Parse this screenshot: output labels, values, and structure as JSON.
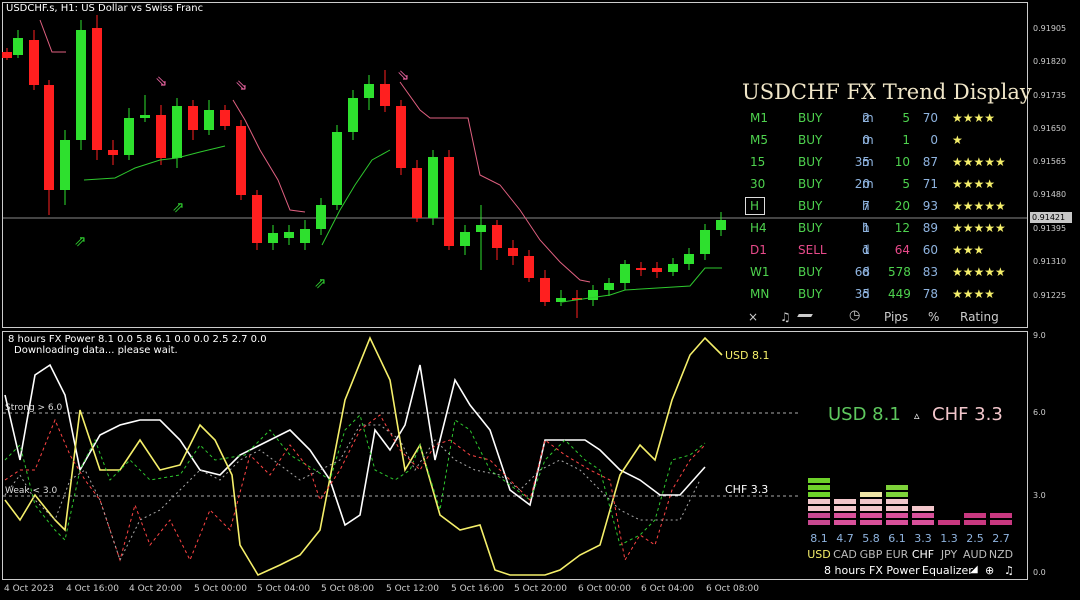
{
  "chart": {
    "title": "USDCHF.s, H1:  US Dollar vs Swiss Franc",
    "current_price": "0.91421",
    "price_axis": [
      "0.91905",
      "0.91820",
      "0.91735",
      "0.91650",
      "0.91565",
      "0.91480",
      "0.91395",
      "0.91310",
      "0.91225"
    ],
    "time_axis": [
      "4 Oct 2023",
      "4 Oct 16:00",
      "4 Oct 20:00",
      "5 Oct 00:00",
      "5 Oct 04:00",
      "5 Oct 08:00",
      "5 Oct 12:00",
      "5 Oct 16:00",
      "5 Oct 20:00",
      "6 Oct 00:00",
      "6 Oct 04:00",
      "6 Oct 08:00"
    ]
  },
  "trend_display": {
    "title": "USDCHF FX Trend Display",
    "rows": [
      {
        "tf": "M1",
        "signal": "BUY",
        "dur": "2",
        "unit": "m",
        "pips": "5",
        "pct": "70",
        "stars": "★★★★",
        "color": "#4ed24e"
      },
      {
        "tf": "M5",
        "signal": "BUY",
        "dur": "0",
        "unit": "m",
        "pips": "1",
        "pct": "0",
        "stars": "★",
        "color": "#4ed24e"
      },
      {
        "tf": "15",
        "signal": "BUY",
        "dur": "35",
        "unit": "m",
        "pips": "10",
        "pct": "87",
        "stars": "★★★★★",
        "color": "#4ed24e"
      },
      {
        "tf": "30",
        "signal": "BUY",
        "dur": "20",
        "unit": "m",
        "pips": "5",
        "pct": "71",
        "stars": "★★★★",
        "color": "#4ed24e"
      },
      {
        "tf": "H",
        "signal": "BUY",
        "dur": "7",
        "unit": "h",
        "pips": "20",
        "pct": "93",
        "stars": "★★★★★",
        "color": "#4ed24e"
      },
      {
        "tf": "H4",
        "signal": "BUY",
        "dur": "1",
        "unit": "h",
        "pips": "12",
        "pct": "89",
        "stars": "★★★★★",
        "color": "#4ed24e"
      },
      {
        "tf": "D1",
        "signal": "SELL",
        "dur": "1",
        "unit": "d",
        "pips": "64",
        "pct": "60",
        "stars": "★★★",
        "color": "#e84a8a"
      },
      {
        "tf": "W1",
        "signal": "BUY",
        "dur": "68",
        "unit": "d",
        "pips": "578",
        "pct": "83",
        "stars": "★★★★★",
        "color": "#4ed24e"
      },
      {
        "tf": "MN",
        "signal": "BUY",
        "dur": "35",
        "unit": "d",
        "pips": "449",
        "pct": "78",
        "stars": "★★★★",
        "color": "#4ed24e"
      }
    ],
    "footer": {
      "close": "×",
      "sound": "♫",
      "clock": "◷",
      "pips": "Pips",
      "pct": "%",
      "rating": "Rating"
    }
  },
  "indicator": {
    "title": "8 hours FX Power 8.1 0.0 5.8 6.1 0.0 0.0 2.5 2.7 0.0",
    "status": "Downloading data... please wait.",
    "strong_label": "Strong > 6.0",
    "weak_label": "Weak < 3.0",
    "axis": [
      "9.0",
      "6.0",
      "3.0",
      "0.0"
    ],
    "usd_label": "USD 8.1",
    "chf_label": "CHF 3.3",
    "headline_usd": "USD 8.1",
    "headline_arrow": "▵",
    "headline_chf": "CHF 3.3"
  },
  "equalizer": {
    "currencies": [
      {
        "code": "USD",
        "value": "8.1",
        "strength": 8.1,
        "code_color": "#f5ef6a"
      },
      {
        "code": "CAD",
        "value": "4.7",
        "strength": 4.7,
        "code_color": "#bbbbbb"
      },
      {
        "code": "GBP",
        "value": "5.8",
        "strength": 5.8,
        "code_color": "#bbbbbb"
      },
      {
        "code": "EUR",
        "value": "6.1",
        "strength": 6.1,
        "code_color": "#bbbbbb"
      },
      {
        "code": "CHF",
        "value": "3.3",
        "strength": 3.3,
        "code_color": "#ffffff"
      },
      {
        "code": "JPY",
        "value": "1.3",
        "strength": 1.3,
        "code_color": "#bbbbbb"
      },
      {
        "code": "AUD",
        "value": "2.5",
        "strength": 2.5,
        "code_color": "#bbbbbb"
      },
      {
        "code": "NZD",
        "value": "2.7",
        "strength": 2.7,
        "code_color": "#bbbbbb"
      }
    ],
    "footer_period": "8 hours",
    "footer_name": "FX Power",
    "footer_mode": "Equalizer",
    "footer_icons": [
      "◢",
      "⊕",
      "♫"
    ]
  }
}
